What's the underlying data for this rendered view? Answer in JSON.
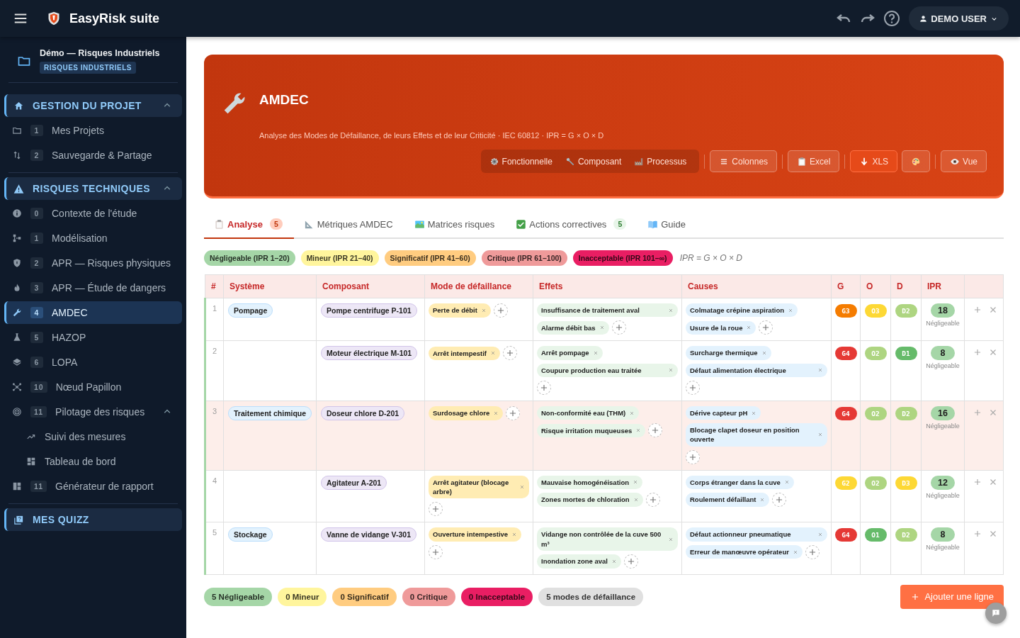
{
  "topbar": {
    "title": "EasyRisk suite",
    "user": "DEMO USER"
  },
  "sidebar": {
    "project": {
      "title": "Démo — Risques Industriels",
      "tag": "RISQUES INDUSTRIELS"
    },
    "sections": [
      {
        "title": "GESTION DU PROJET",
        "kind": "home",
        "expanded": true,
        "items": [
          {
            "kind": "folder",
            "badge": "1",
            "label": "Mes Projets",
            "selected": false
          },
          {
            "kind": "swap",
            "badge": "2",
            "label": "Sauvegarde & Partage",
            "selected": false
          }
        ]
      },
      {
        "title": "RISQUES TECHNIQUES",
        "kind": "warning",
        "expanded": true,
        "items": [
          {
            "kind": "info",
            "badge": "0",
            "label": "Contexte de l'étude",
            "selected": false
          },
          {
            "kind": "tree",
            "badge": "1",
            "label": "Modélisation",
            "selected": false
          },
          {
            "kind": "shield",
            "badge": "2",
            "label": "APR — Risques physiques",
            "selected": false
          },
          {
            "kind": "fire",
            "badge": "3",
            "label": "APR — Étude de dangers",
            "selected": false
          },
          {
            "kind": "wrench",
            "badge": "4",
            "label": "AMDEC",
            "selected": true
          },
          {
            "kind": "flask",
            "badge": "5",
            "label": "HAZOP",
            "selected": false
          },
          {
            "kind": "layers",
            "badge": "6",
            "label": "LOPA",
            "selected": false
          },
          {
            "kind": "network",
            "badge": "10",
            "label": "Nœud Papillon",
            "selected": false
          },
          {
            "kind": "target",
            "badge": "11",
            "label": "Pilotage des risques",
            "selected": false,
            "expanded": true,
            "children": [
              {
                "kind": "trend",
                "label": "Suivi des mesures",
                "selected": false
              },
              {
                "kind": "dashboard",
                "label": "Tableau de bord",
                "selected": false
              }
            ]
          },
          {
            "kind": "report",
            "badge": "11",
            "label": "Générateur de rapport",
            "selected": false
          }
        ]
      },
      {
        "title": "MES QUIZZ",
        "kind": "quiz"
      }
    ]
  },
  "header": {
    "title": "AMDEC",
    "subtitle": "Analyse des Modes de Défaillance, de leurs Effets et de leur Criticité · IEC 60812 · IPR = G × O × D",
    "view_modes": [
      {
        "kind": "gear",
        "label": "Fonctionnelle"
      },
      {
        "kind": "bolt",
        "label": "Composant"
      },
      {
        "kind": "factory",
        "label": "Processus"
      }
    ],
    "toolbar_groups": [
      [
        {
          "kind": "lines",
          "label": "Colonnes",
          "highlighted": false
        }
      ],
      [
        {
          "kind": "clipboard",
          "label": "Excel",
          "highlighted": false
        }
      ],
      [
        {
          "kind": "download",
          "label": "XLS",
          "highlighted": true
        },
        {
          "kind": "palette",
          "highlighted": false
        }
      ],
      [
        {
          "kind": "eye",
          "label": "Vue",
          "highlighted": false
        }
      ]
    ]
  },
  "tabs": [
    {
      "kind": "clipboard",
      "label": "Analyse",
      "count": "5",
      "selected": true
    },
    {
      "kind": "ruler",
      "label": "Métriques AMDEC",
      "selected": false
    },
    {
      "kind": "map",
      "label": "Matrices risques",
      "selected": false
    },
    {
      "kind": "check",
      "label": "Actions correctives",
      "count": "5",
      "selected": false
    },
    {
      "kind": "book",
      "label": "Guide",
      "selected": false
    }
  ],
  "legend": [
    {
      "label": "Négligeable (IPR 1–20)",
      "color": "#a5d6a7"
    },
    {
      "label": "Mineur (IPR 21–40)",
      "color": "#fff59d"
    },
    {
      "label": "Significatif (IPR 41–60)",
      "color": "#ffcc80"
    },
    {
      "label": "Critique (IPR 61–100)",
      "color": "#ef9a9a"
    },
    {
      "label": "Inacceptable (IPR 101–∞)",
      "color": "#e91e63"
    }
  ],
  "formula": "IPR = G × O × D",
  "table": {
    "columns": [
      "#",
      "Système",
      "Composant",
      "Mode de défaillance",
      "Effets",
      "Causes",
      "G",
      "O",
      "D",
      "IPR"
    ],
    "rows": [
      {
        "num": "1",
        "system": "Pompage",
        "component": "Pompe centrifuge P-101",
        "modes": [
          "Perte de débit"
        ],
        "effects": [
          "Insuffisance de traitement aval",
          "Alarme débit bas"
        ],
        "causes": [
          "Colmatage crépine aspiration",
          "Usure de la roue"
        ],
        "scores": [
          {
            "label": "G3",
            "color": "#f57c00"
          },
          {
            "label": "O3",
            "color": "#fdd835"
          },
          {
            "label": "D2",
            "color": "#aed581"
          }
        ],
        "ipr": "18",
        "ipr_level": "Négligeable",
        "highlighted": false
      },
      {
        "num": "2",
        "component": "Moteur électrique M-101",
        "modes": [
          "Arrêt intempestif"
        ],
        "effects": [
          "Arrêt pompage",
          "Coupure production eau traitée"
        ],
        "causes": [
          "Surcharge thermique",
          "Défaut alimentation électrique"
        ],
        "scores": [
          {
            "label": "G4",
            "color": "#e53935"
          },
          {
            "label": "O2",
            "color": "#aed581"
          },
          {
            "label": "D1",
            "color": "#66bb6a"
          }
        ],
        "ipr": "8",
        "ipr_level": "Négligeable",
        "highlighted": false
      },
      {
        "num": "3",
        "system": "Traitement chimique",
        "component": "Doseur chlore D-201",
        "modes": [
          "Surdosage chlore"
        ],
        "effects": [
          "Non-conformité eau (THM)",
          "Risque irritation muqueuses"
        ],
        "causes": [
          "Dérive capteur pH",
          "Blocage clapet doseur en position ouverte"
        ],
        "scores": [
          {
            "label": "G4",
            "color": "#e53935"
          },
          {
            "label": "O2",
            "color": "#aed581"
          },
          {
            "label": "D2",
            "color": "#aed581"
          }
        ],
        "ipr": "16",
        "ipr_level": "Négligeable",
        "highlighted": true
      },
      {
        "num": "4",
        "component": "Agitateur A-201",
        "modes": [
          "Arrêt agitateur (blocage arbre)"
        ],
        "effects": [
          "Mauvaise homogénéisation",
          "Zones mortes de chloration"
        ],
        "causes": [
          "Corps étranger dans la cuve",
          "Roulement défaillant"
        ],
        "scores": [
          {
            "label": "G2",
            "color": "#fdd835"
          },
          {
            "label": "O2",
            "color": "#aed581"
          },
          {
            "label": "D3",
            "color": "#fdd835"
          }
        ],
        "ipr": "12",
        "ipr_level": "Négligeable",
        "highlighted": false
      },
      {
        "num": "5",
        "system": "Stockage",
        "component": "Vanne de vidange V-301",
        "modes": [
          "Ouverture intempestive"
        ],
        "effects": [
          "Vidange non contrôlée de la cuve 500 m³",
          "Inondation zone aval"
        ],
        "causes": [
          "Défaut actionneur pneumatique",
          "Erreur de manœuvre opérateur"
        ],
        "scores": [
          {
            "label": "G4",
            "color": "#e53935"
          },
          {
            "label": "O1",
            "color": "#66bb6a"
          },
          {
            "label": "D2",
            "color": "#aed581"
          }
        ],
        "ipr": "8",
        "ipr_level": "Négligeable",
        "highlighted": false
      }
    ]
  },
  "summary": [
    {
      "label": "5 Négligeable",
      "color": "#a5d6a7"
    },
    {
      "label": "0 Mineur",
      "color": "#fff59d"
    },
    {
      "label": "0 Significatif",
      "color": "#ffcc80"
    },
    {
      "label": "0 Critique",
      "color": "#ef9a9a"
    },
    {
      "label": "0 Inacceptable",
      "color": "#e91e63"
    },
    {
      "label": "5 modes de défaillance",
      "color": "#e0e0e0"
    }
  ],
  "add_button": "Ajouter une ligne"
}
